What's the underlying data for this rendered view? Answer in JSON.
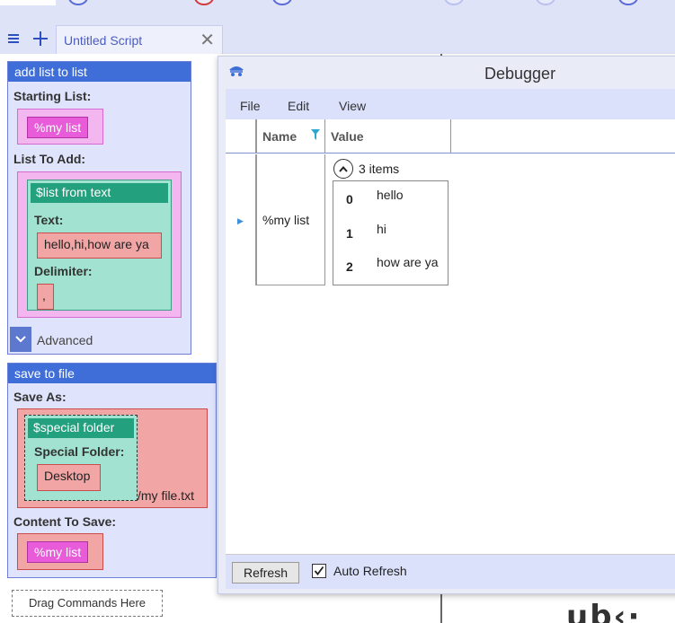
{
  "tabbar": {
    "menu_icon": "hamburger-icon",
    "add_icon": "plus-icon",
    "tab_label": "Untitled Script",
    "close_glyph": "✕"
  },
  "script": {
    "add_list": {
      "title": "add list to list",
      "starting_label": "Starting List:",
      "starting_value": "%my list",
      "add_label": "List To Add:",
      "from_text": {
        "title": "$list from text",
        "text_label": "Text:",
        "text_value": "hello,hi,how are ya",
        "delim_label": "Delimiter:",
        "delim_value": ","
      },
      "advanced_label": "Advanced"
    },
    "save_file": {
      "title": "save to file",
      "save_as_label": "Save As:",
      "special_folder": {
        "title": "$special folder",
        "folder_label": "Special Folder:",
        "folder_value": "Desktop"
      },
      "path_suffix": "/my file.txt",
      "content_label": "Content To Save:",
      "content_value": "%my list"
    },
    "drag_hint": "Drag Commands Here"
  },
  "debugger": {
    "title": "Debugger",
    "menu": [
      "File",
      "Edit",
      "View"
    ],
    "columns": {
      "name": "Name",
      "value": "Value"
    },
    "row": {
      "name": "%my list",
      "items_count": "3 items",
      "items": [
        {
          "index": "0",
          "value": "hello"
        },
        {
          "index": "1",
          "value": "hi"
        },
        {
          "index": "2",
          "value": "how are ya"
        }
      ]
    },
    "refresh_label": "Refresh",
    "auto_refresh_label": "Auto Refresh",
    "auto_refresh_checked": true
  },
  "colors": {
    "command_header": "#3f6ed8",
    "variable_pill": "#e85bd9",
    "function_header": "#23a07e",
    "string_box": "#f2a5a5"
  }
}
